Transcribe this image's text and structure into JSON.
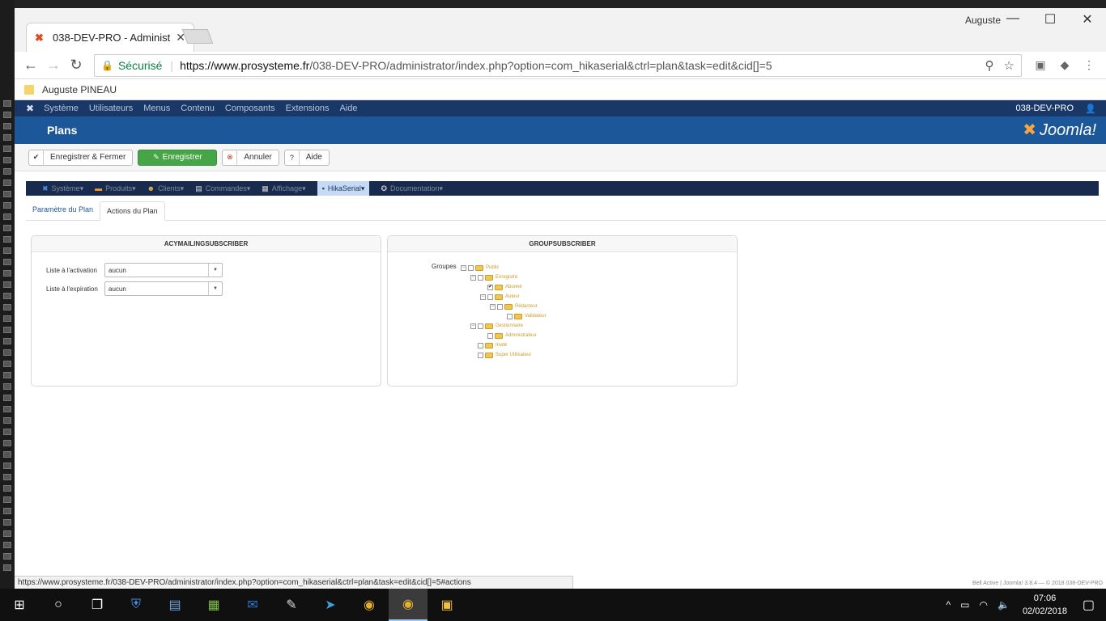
{
  "window": {
    "user": "Auguste",
    "tab_title": "038-DEV-PRO - Administ",
    "minimize": "—",
    "maximize": "☐",
    "close": "✕"
  },
  "address": {
    "secure_label": "Sécurisé",
    "url_host": "https://www.prosysteme.fr",
    "url_path": "/038-DEV-PRO/administrator/index.php?option=com_hikaserial&ctrl=plan&task=edit&cid[]=5"
  },
  "bookmarks": {
    "items": [
      "Auguste PINEAU"
    ]
  },
  "joomla": {
    "topnav": [
      "Système",
      "Utilisateurs",
      "Menus",
      "Contenu",
      "Composants",
      "Extensions",
      "Aide"
    ],
    "site_name": "038-DEV-PRO",
    "page_title": "Plans",
    "brand": "Joomla!"
  },
  "toolbar": {
    "save_close": "Enregistrer & Fermer",
    "save": "Enregistrer",
    "cancel": "Annuler",
    "help": "Aide"
  },
  "hikanav": {
    "items": [
      "Système",
      "Produits",
      "Clients",
      "Commandes",
      "Affichage",
      "HikaSerial",
      "Documentation"
    ],
    "active_index": 5
  },
  "subtabs": [
    "Paramètre du Plan",
    "Actions du Plan"
  ],
  "acy_panel": {
    "title": "ACYMAILINGSUBSCRIBER",
    "activation_label": "Liste à l'activation",
    "activation_value": "aucun",
    "expiration_label": "Liste à l'expiration",
    "expiration_value": "aucun"
  },
  "group_panel": {
    "title": "GROUPSUBSCRIBER",
    "label": "Groupes",
    "tree": [
      "Public",
      "Enregistré",
      "Abonné",
      "Auteur",
      "Rédacteur",
      "Validateur",
      "Gestionnaire",
      "Administrateur",
      "Invité",
      "Super Utilisateur"
    ],
    "checked": [
      "Abonné"
    ]
  },
  "status": {
    "hover_url": "https://www.prosysteme.fr/038-DEV-PRO/administrator/index.php?option=com_hikaserial&ctrl=plan&task=edit&cid[]=5#actions",
    "footer": "Bell Active   |   Joomla! 3.8.4   —   © 2018 038-DEV-PRO"
  },
  "taskbar": {
    "time": "07:06",
    "date": "02/02/2018"
  }
}
